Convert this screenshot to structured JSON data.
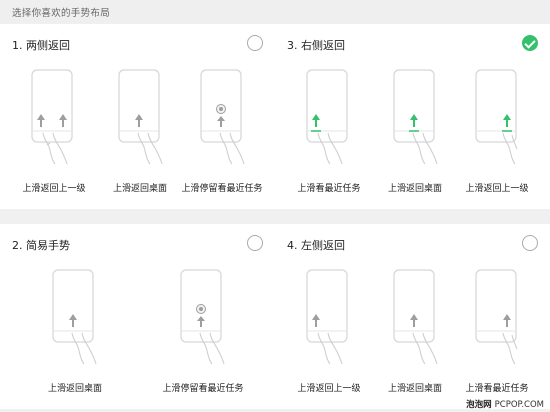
{
  "header": {
    "title": "选择你喜欢的手势布局"
  },
  "options": [
    {
      "title": "1. 两侧返回",
      "selected": false,
      "captions": [
        "上滑返回上一级",
        "上滑返回桌面",
        "上滑停留看最近任务"
      ]
    },
    {
      "title": "3. 右侧返回",
      "selected": true,
      "captions": [
        "上滑看最近任务",
        "上滑返回桌面",
        "上滑返回上一级"
      ]
    },
    {
      "title": "2. 简易手势",
      "selected": false,
      "captions": [
        "上滑返回桌面",
        "上滑停留看最近任务"
      ]
    },
    {
      "title": "4. 左侧返回",
      "selected": false,
      "captions": [
        "上滑返回上一级",
        "上滑返回桌面",
        "上滑看最近任务"
      ]
    }
  ],
  "colors": {
    "accent": "#33c16b",
    "arrow_gray": "#9e9e9e",
    "outline": "#d6d6d6"
  },
  "watermark": {
    "site": "泡泡网",
    "url": "PCPOP.COM"
  }
}
